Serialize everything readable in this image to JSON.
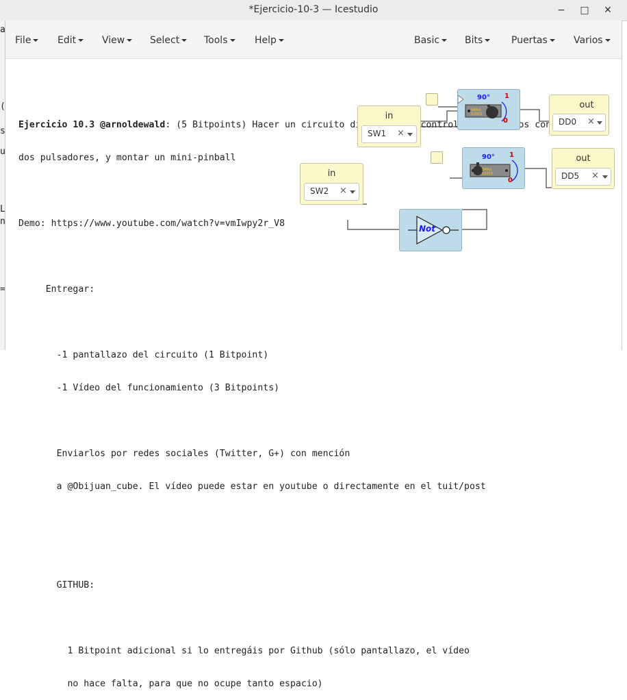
{
  "window": {
    "title": "*Ejercicio-10-3 — Icestudio",
    "controls": {
      "minimize": "−",
      "maximize": "□",
      "close": "✕"
    }
  },
  "background_fragments": [
    "a",
    "(",
    "s",
    "u",
    "L",
    "n",
    "="
  ],
  "menu": {
    "left": [
      {
        "label": "File"
      },
      {
        "label": "Edit"
      },
      {
        "label": "View"
      },
      {
        "label": "Select"
      },
      {
        "label": "Tools"
      },
      {
        "label": "Help"
      }
    ],
    "right": [
      {
        "label": "Basic"
      },
      {
        "label": "Bits"
      },
      {
        "label": "Puertas"
      },
      {
        "label": "Varios"
      }
    ]
  },
  "note": {
    "heading": "Ejercicio 10.3 @arnoldewald",
    "lines": [
      "Ejercicio 10.3 @arnoldewald: (5 Bitpoints) Hacer un circuito digital para controlar dos servos con",
      "dos pulsadores, y montar un mini-pinball",
      "",
      "Demo: https://www.youtube.com/watch?v=vmIwpy2r_V8",
      "",
      "     Entregar:",
      "",
      "       -1 pantallazo del circuito (1 Bitpoint)",
      "       -1 Vídeo del funcionamiento (3 Bitpoints)",
      "",
      "       Enviarlos por redes sociales (Twitter, G+) con mención",
      "       a @Obijuan_cube. El vídeo puede estar en youtube o directamente en el tuit/post",
      "",
      "",
      "       GITHUB:",
      "",
      "         1 Bitpoint adicional si lo entregáis por Github (sólo pantallazo, el vídeo",
      "         no hace falta, para que no ocupe tanto espacio)"
    ]
  },
  "blocks": {
    "input1": {
      "label": "in",
      "value": "SW1",
      "clear": "×"
    },
    "input2": {
      "label": "in",
      "value": "SW2",
      "clear": "×"
    },
    "output1": {
      "label": "out",
      "value": "DD0",
      "clear": "×"
    },
    "output2": {
      "label": "out",
      "value": "DD5",
      "clear": "×"
    },
    "not_gate": {
      "label": "Not"
    },
    "servo1": {
      "angle": "90°",
      "one": "1",
      "zero": "0",
      "brand": "SMAX\nS3003"
    },
    "servo2": {
      "angle": "90°",
      "one": "1",
      "zero": "0",
      "brand": "SMAX\nS3003"
    }
  },
  "colors": {
    "input_block": "#fbf8c9",
    "servo_block": "#bddbe8",
    "wire": "#666666",
    "not_text": "#1a1aff"
  }
}
